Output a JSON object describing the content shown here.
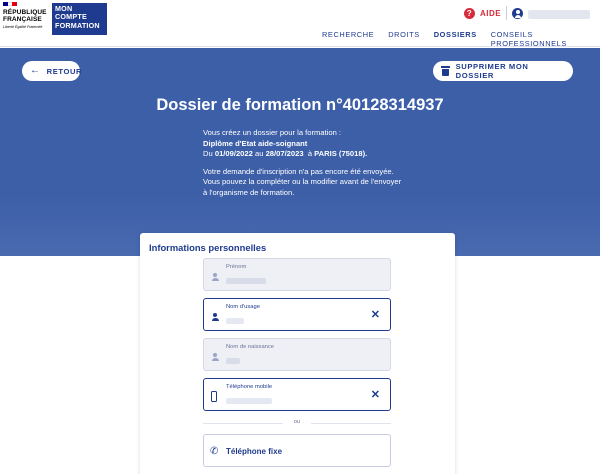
{
  "header": {
    "rf_name_lines": [
      "RÉPUBLIQUE",
      "FRANÇAISE"
    ],
    "rf_motto": "Liberté Égalité Fraternité",
    "brand_lines": [
      "MON",
      "COMPTE",
      "FORMATION"
    ],
    "help_label": "AIDE",
    "nav": [
      "RECHERCHE",
      "DROITS",
      "DOSSIERS",
      "CONSEILS PROFESSIONNELS"
    ],
    "active_nav": "DOSSIERS"
  },
  "hero": {
    "back_label": "RETOUR",
    "delete_label": "SUPPRIMER MON DOSSIER",
    "title": "Dossier de formation n°40128314937",
    "intro": "Vous créez un dossier pour la formation :",
    "course": "Diplôme d'Etat aide-soignant",
    "date_prefix": "Du",
    "date_from": "01/09/2022",
    "date_mid": "au",
    "date_to": "28/07/2023",
    "location_prefix": "à",
    "location": "PARIS (75018).",
    "notice": "Votre demande d'inscription n'a pas encore été envoyée. Vous pouvez la compléter ou la modifier avant de l'envoyer à l'organisme de formation."
  },
  "form": {
    "section_title": "Informations personnelles",
    "fields": [
      {
        "label": "Prénom"
      },
      {
        "label": "Nom d'usage"
      },
      {
        "label": "Nom de naissance"
      },
      {
        "label": "Téléphone mobile"
      }
    ],
    "or_label": "ou",
    "landline_label": "Téléphone fixe"
  },
  "colors": {
    "primary": "#1f3b8f",
    "hero_bg": "#3d5fa8",
    "alert": "#d62b3a",
    "flag": [
      "#000091",
      "#ffffff",
      "#e1000f"
    ]
  }
}
